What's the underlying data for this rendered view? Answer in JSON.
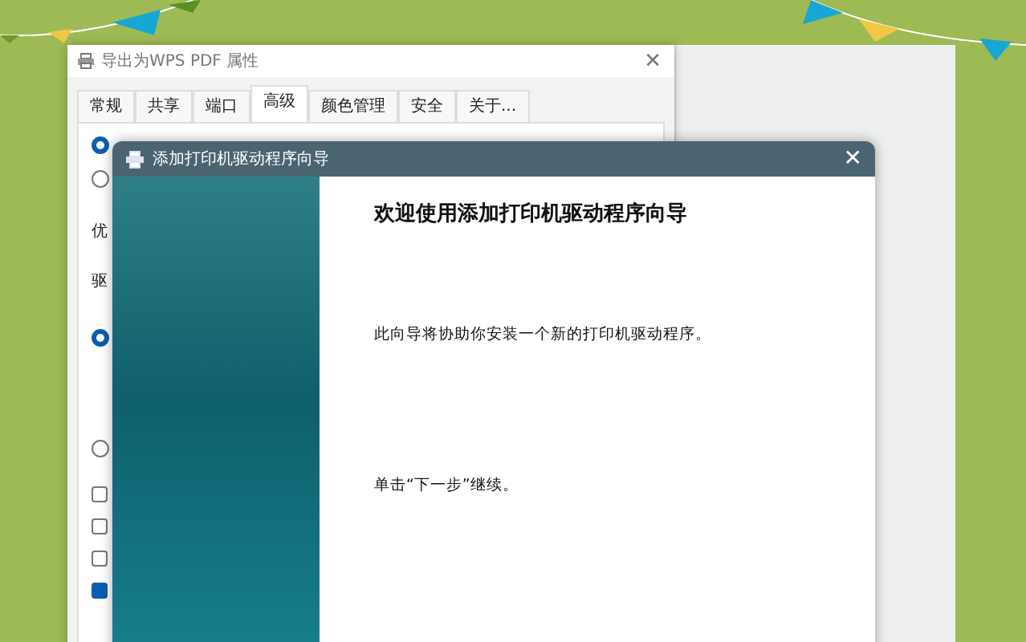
{
  "back_window": {
    "title": "导出为WPS PDF 属性",
    "close_label": "✕",
    "tabs": [
      {
        "label": "常规",
        "selected": false
      },
      {
        "label": "共享",
        "selected": false
      },
      {
        "label": "端口",
        "selected": false
      },
      {
        "label": "高级",
        "selected": true
      },
      {
        "label": "颜色管理",
        "selected": false
      },
      {
        "label": "安全",
        "selected": false
      },
      {
        "label": "关于...",
        "selected": false
      }
    ],
    "options": [
      {
        "kind": "radio",
        "checked": true
      },
      {
        "kind": "radio",
        "checked": false
      },
      {
        "kind": "text",
        "text": "优"
      },
      {
        "kind": "text",
        "text": "驱"
      },
      {
        "kind": "radio",
        "checked": true
      },
      {
        "kind": "radio",
        "checked": false
      },
      {
        "kind": "checkbox",
        "checked": false
      },
      {
        "kind": "checkbox",
        "checked": false
      },
      {
        "kind": "checkbox",
        "checked": false
      },
      {
        "kind": "checkbox",
        "checked": true
      }
    ]
  },
  "wizard": {
    "title": "添加打印机驱动程序向导",
    "close_label": "✕",
    "heading": "欢迎使用添加打印机驱动程序向导",
    "paragraphs": [
      "此向导将协助你安装一个新的打印机驱动程序。",
      "单击“下一步”继续。"
    ]
  }
}
